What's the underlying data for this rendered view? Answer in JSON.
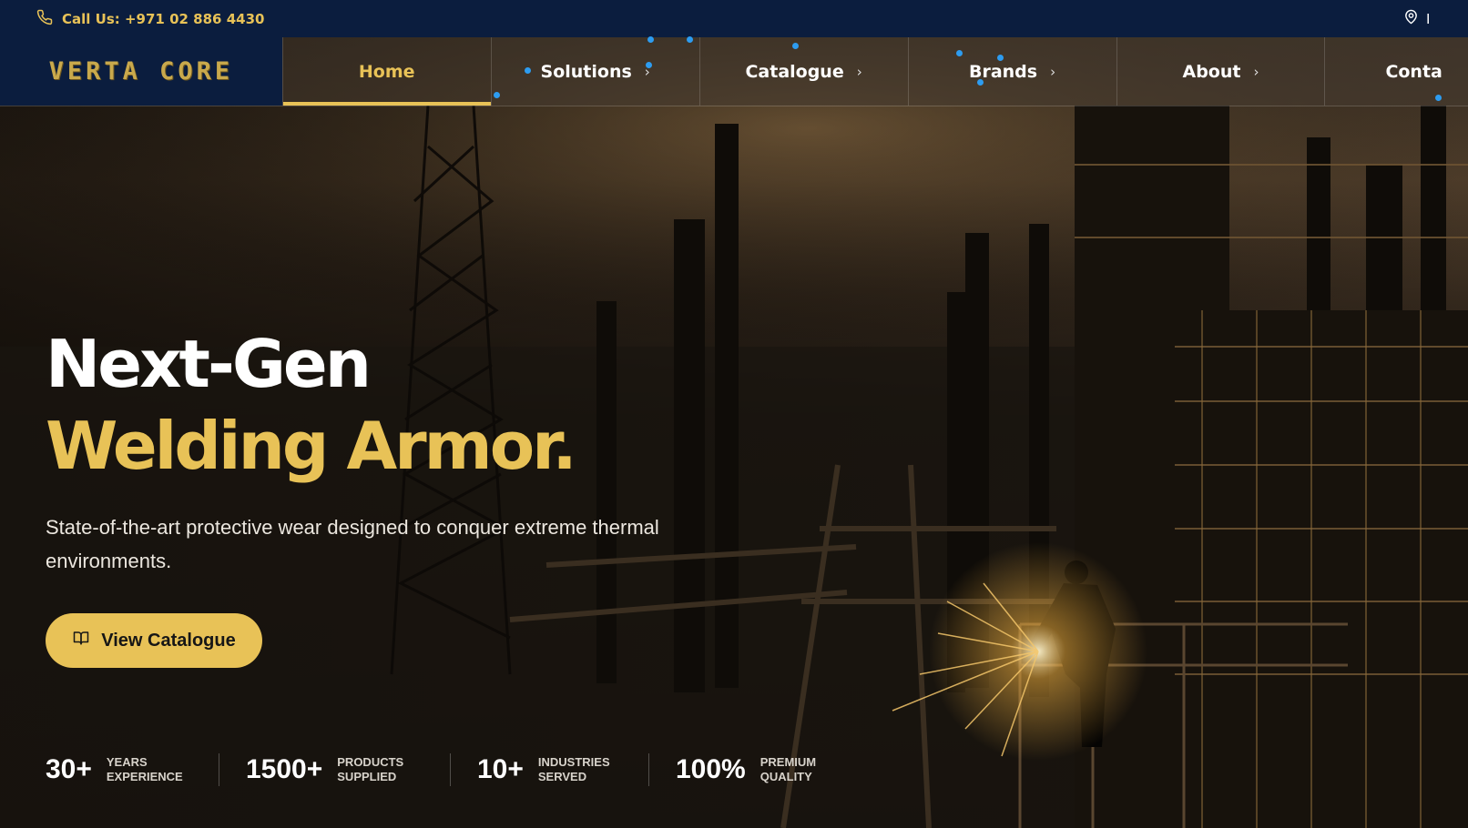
{
  "topbar": {
    "call_text": "Call Us: +971 02 886 4430",
    "phone_icon": "phone-icon",
    "location_icon": "map-pin-icon",
    "location_text": "I"
  },
  "nav": {
    "logo": "VERTA CORE",
    "items": [
      {
        "label": "Home",
        "active": true,
        "has_chevron": false
      },
      {
        "label": "Solutions",
        "has_chevron": true
      },
      {
        "label": "Catalogue",
        "has_chevron": true
      },
      {
        "label": "Brands",
        "has_chevron": true
      },
      {
        "label": "About",
        "has_chevron": true
      },
      {
        "label": "Conta",
        "has_chevron": false
      }
    ],
    "chevron": "›"
  },
  "hero": {
    "title_line1": "Next-Gen",
    "title_line2": "Welding Armor.",
    "subtitle": "State-of-the-art protective wear designed to conquer extreme thermal environments.",
    "cta_label": "View Catalogue",
    "cta_icon": "book-open-icon"
  },
  "stats": [
    {
      "value": "30+",
      "label": "YEARS EXPERIENCE"
    },
    {
      "value": "1500+",
      "label": "PRODUCTS SUPPLIED"
    },
    {
      "value": "10+",
      "label": "INDUSTRIES SERVED"
    },
    {
      "value": "100%",
      "label": "PREMIUM QUALITY"
    }
  ],
  "colors": {
    "navy": "#0b1d3e",
    "gold": "#e8c257",
    "accent_dot": "#2d9cf0"
  }
}
